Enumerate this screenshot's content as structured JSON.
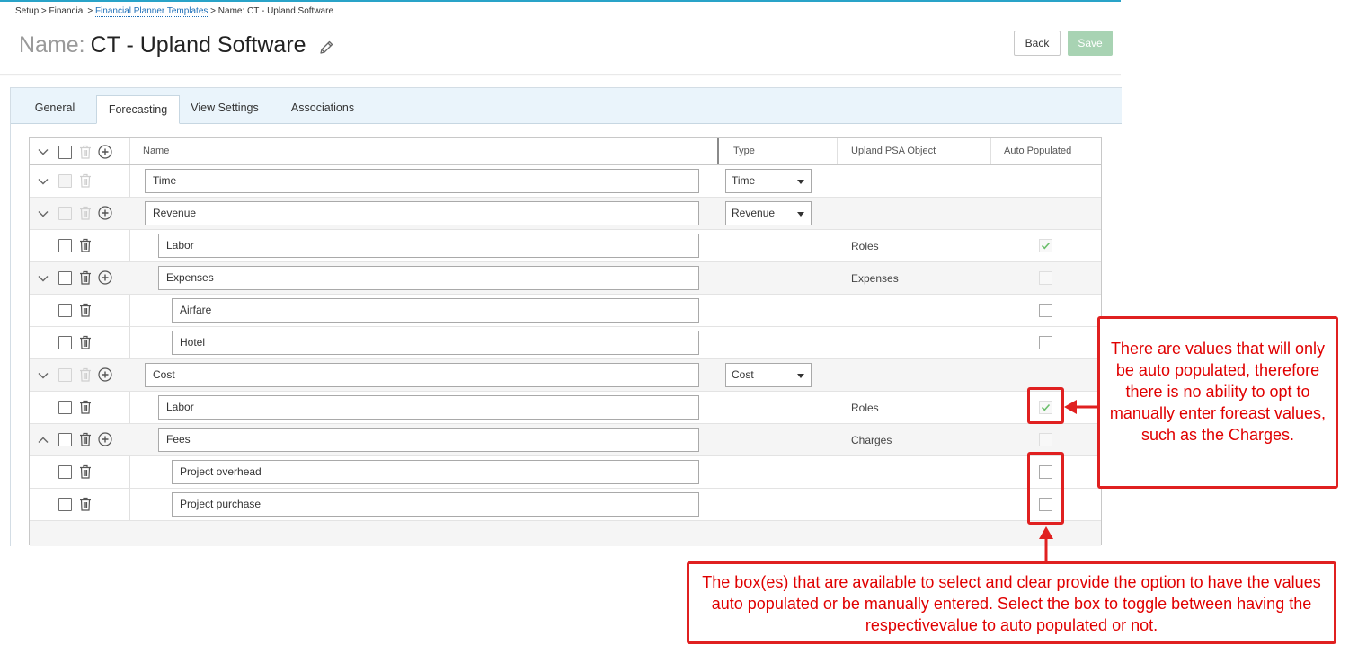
{
  "breadcrumb": {
    "part1": "Setup > Financial > ",
    "link": "Financial Planner Templates",
    "part2": " > Name: CT - Upland Software"
  },
  "header": {
    "name_label": "Name:",
    "name_value": "CT - Upland Software",
    "back_label": "Back",
    "save_label": "Save"
  },
  "tabs": [
    {
      "label": "General"
    },
    {
      "label": "Forecasting"
    },
    {
      "label": "View Settings"
    },
    {
      "label": "Associations"
    }
  ],
  "grid": {
    "columns": {
      "name": "Name",
      "type": "Type",
      "object": "Upland PSA Object",
      "auto": "Auto Populated"
    },
    "rows": [
      {
        "name": "Time",
        "type": "Time",
        "object": "",
        "auto": "none"
      },
      {
        "name": "Revenue",
        "type": "Revenue",
        "object": "",
        "auto": "none"
      },
      {
        "name": "Labor",
        "type": "",
        "object": "Roles",
        "auto": "checked-disabled"
      },
      {
        "name": "Expenses",
        "type": "",
        "object": "Expenses",
        "auto": "disabled"
      },
      {
        "name": "Airfare",
        "type": "",
        "object": "",
        "auto": "enabled"
      },
      {
        "name": "Hotel",
        "type": "",
        "object": "",
        "auto": "enabled"
      },
      {
        "name": "Cost",
        "type": "Cost",
        "object": "",
        "auto": "none"
      },
      {
        "name": "Labor",
        "type": "",
        "object": "Roles",
        "auto": "checked-disabled"
      },
      {
        "name": "Fees",
        "type": "",
        "object": "Charges",
        "auto": "disabled"
      },
      {
        "name": "Project overhead",
        "type": "",
        "object": "",
        "auto": "enabled"
      },
      {
        "name": "Project purchase",
        "type": "",
        "object": "",
        "auto": "enabled"
      }
    ]
  },
  "annotations": {
    "right": "There are values that will only be auto populated, therefore there is no ability to opt to manually enter foreast values, such as the Charges.",
    "bottom": "The box(es) that are available to select and clear  provide the option to have the values auto populated or be manually entered. Select the box to toggle between having the respectivevalue to auto populated or not."
  },
  "colors": {
    "accent": "#29a3c8",
    "annotation_red": "#e02020",
    "save_disabled": "#a8d3b3",
    "check_green": "#6cbf6c"
  },
  "icons": [
    "pencil-icon",
    "chevron-down-icon",
    "chevron-up-icon",
    "trash-icon",
    "plus-circle-icon",
    "checkmark-icon"
  ]
}
